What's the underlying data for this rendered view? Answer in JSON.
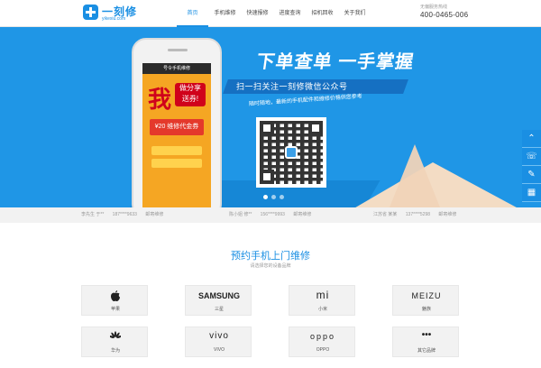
{
  "header": {
    "logo_text": "一刻修",
    "logo_sub": "yikexiu.com",
    "nav": [
      "首页",
      "手机维修",
      "快速报修",
      "进度查询",
      "招机回收",
      "关于我们"
    ],
    "active_nav": 0,
    "hotline_label": "无偏服务热线",
    "hotline_number": "400-0465-006"
  },
  "banner": {
    "title": "下单查单  一手掌握",
    "subtitle": "扫一扫关注一刻修微信公众号",
    "description": "随时随地，最新的手机配件和维修价格供您参考",
    "phone_status": "号令手机维修",
    "phone_promo_big": "我",
    "phone_promo_tag": "做分享 送券!",
    "phone_coupon": "¥20 维修代金券",
    "slides": 3,
    "active_slide": 0,
    "colors": {
      "banner": "#1f96e6",
      "accent": "#1a8fe3"
    }
  },
  "side_widgets": [
    {
      "icon": "chevron-up-icon",
      "glyph": "⌃"
    },
    {
      "icon": "phone-icon",
      "glyph": "☏"
    },
    {
      "icon": "edit-icon",
      "glyph": "✎"
    },
    {
      "icon": "qr-icon",
      "glyph": "▦"
    }
  ],
  "ticker": [
    {
      "name": "李先生 于**",
      "phone": "187****9633",
      "status": "邮寄维修"
    },
    {
      "name": "陈小姐 修**",
      "phone": "156****9993",
      "status": "邮寄维修"
    },
    {
      "name": "江苏省 某某",
      "phone": "137****5298",
      "status": "邮寄维修"
    }
  ],
  "section": {
    "title": "预约手机上门维修",
    "subtitle": "请选择您的设备品牌"
  },
  "brands": [
    {
      "logo": "",
      "icon": "apple-icon",
      "name": "苹果"
    },
    {
      "logo": "SAMSUNG",
      "name": "三星"
    },
    {
      "logo": "mi",
      "name": "小米"
    },
    {
      "logo": "MEIZU",
      "name": "魅族"
    },
    {
      "logo": "",
      "icon": "huawei-icon",
      "name": "华为"
    },
    {
      "logo": "vivo",
      "name": "VIVO"
    },
    {
      "logo": "oppo",
      "name": "OPPO"
    },
    {
      "logo": "•••",
      "name": "其它品牌"
    }
  ]
}
